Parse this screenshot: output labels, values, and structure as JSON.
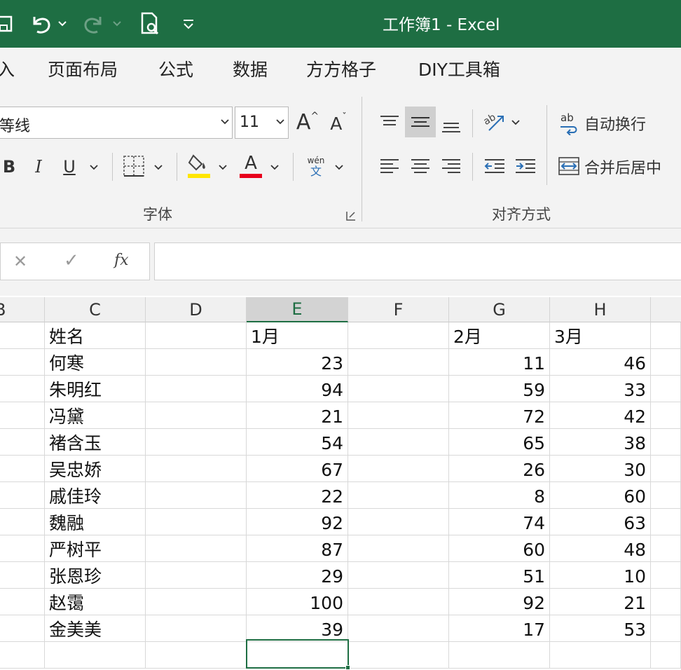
{
  "titlebar": {
    "title": "工作簿1  -  Excel",
    "icons": [
      "save-icon",
      "undo-icon",
      "redo-icon",
      "print-preview-icon",
      "customize-qat-icon"
    ]
  },
  "menu": {
    "tabs": [
      "入",
      "页面布局",
      "公式",
      "数据",
      "方方格子",
      "DIY工具箱"
    ]
  },
  "ribbon": {
    "font_group": {
      "font_name": "等线",
      "font_size": "11",
      "bold": "B",
      "italic": "I",
      "underline": "U",
      "font_color_letter": "A",
      "increase_font": "A",
      "decrease_font": "A",
      "phonetic_top": "wén",
      "phonetic_bottom": "文",
      "label": "字体",
      "fill_color": "#ffe600",
      "font_color": "#e8001c"
    },
    "align_group": {
      "wrap_text": "自动换行",
      "wrap_icon_text": "ab",
      "merge_center": "合并后居中",
      "label": "对齐方式"
    }
  },
  "formula_bar": {
    "cancel": "✕",
    "enter": "✓",
    "fx": "fx",
    "value": ""
  },
  "grid": {
    "partial_col": "B",
    "columns": [
      "C",
      "D",
      "E",
      "F",
      "G",
      "H"
    ],
    "selected_column": "E",
    "header": {
      "name": "姓名",
      "m1": "1月",
      "m2": "2月",
      "m3": "3月"
    },
    "rows": [
      {
        "name": "何寒",
        "m1": "23",
        "m2": "11",
        "m3": "46"
      },
      {
        "name": "朱明红",
        "m1": "94",
        "m2": "59",
        "m3": "33"
      },
      {
        "name": "冯黛",
        "m1": "21",
        "m2": "72",
        "m3": "42"
      },
      {
        "name": "褚含玉",
        "m1": "54",
        "m2": "65",
        "m3": "38"
      },
      {
        "name": "吴忠娇",
        "m1": "67",
        "m2": "26",
        "m3": "30"
      },
      {
        "name": "戚佳玲",
        "m1": "22",
        "m2": "8",
        "m3": "60"
      },
      {
        "name": "魏融",
        "m1": "92",
        "m2": "74",
        "m3": "63"
      },
      {
        "name": "严树平",
        "m1": "87",
        "m2": "60",
        "m3": "48"
      },
      {
        "name": "张恩珍",
        "m1": "29",
        "m2": "51",
        "m3": "10"
      },
      {
        "name": "赵霭",
        "m1": "100",
        "m2": "92",
        "m3": "21"
      },
      {
        "name": "金美美",
        "m1": "39",
        "m2": "17",
        "m3": "53"
      }
    ]
  }
}
